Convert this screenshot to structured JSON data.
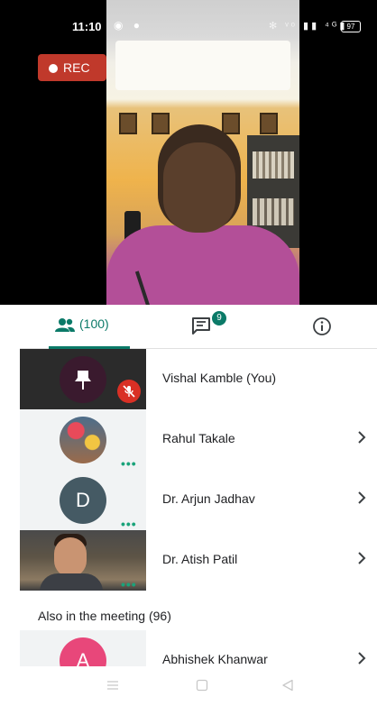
{
  "status_bar": {
    "time": "11:10",
    "left_icons": "◉ ●",
    "right_icons": "✻ ᵛᵒ ▮▮ ⁴ᴳ▮",
    "battery": "97"
  },
  "recording": {
    "label": "REC"
  },
  "tabs": {
    "people_count": "(100)",
    "chat_badge": "9"
  },
  "participants": [
    {
      "name": "Vishal Kamble (You)",
      "avatar": "pin-icon",
      "muted": true
    },
    {
      "name": "Rahul Takale",
      "avatar": "photo"
    },
    {
      "name": "Dr. Arjun Jadhav",
      "avatar": "D"
    },
    {
      "name": "Dr. Atish Patil",
      "avatar": "video"
    }
  ],
  "also_in_meeting": {
    "header": "Also in the meeting (96)",
    "first": {
      "name": "Abhishek Khanwar",
      "initial": "A"
    }
  },
  "colors": {
    "accent": "#0b7a68",
    "rec": "#c0392b",
    "mute": "#d93025"
  }
}
